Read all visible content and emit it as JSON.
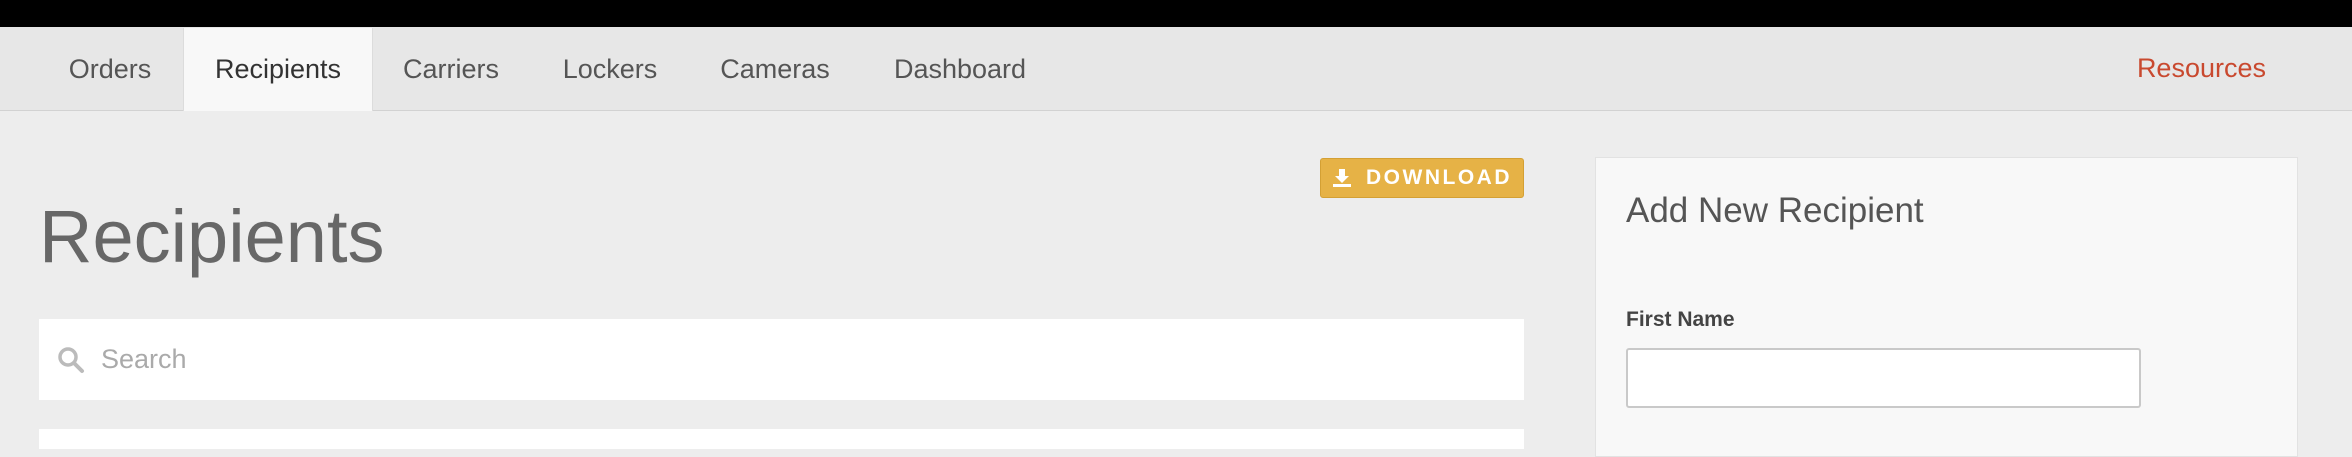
{
  "nav": {
    "tabs": [
      {
        "label": "Orders",
        "active": false
      },
      {
        "label": "Recipients",
        "active": true
      },
      {
        "label": "Carriers",
        "active": false
      },
      {
        "label": "Lockers",
        "active": false
      },
      {
        "label": "Cameras",
        "active": false
      },
      {
        "label": "Dashboard",
        "active": false
      }
    ],
    "right_link": "Resources"
  },
  "toolbar": {
    "download_label": "DOWNLOAD",
    "download_icon": "download-icon"
  },
  "main": {
    "title": "Recipients",
    "search": {
      "placeholder": "Search",
      "value": "",
      "icon": "search-icon"
    }
  },
  "sidebar_form": {
    "title": "Add New Recipient",
    "fields": [
      {
        "label": "First Name",
        "value": ""
      }
    ]
  },
  "colors": {
    "accent_link": "#c9492f",
    "download_button": "#e6b246",
    "title_text": "#676767",
    "nav_bg": "#e7e7e7",
    "page_bg": "#ededed"
  }
}
